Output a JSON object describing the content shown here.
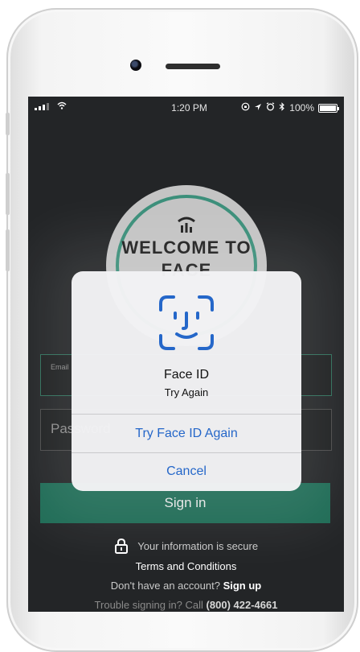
{
  "status_bar": {
    "time": "1:20 PM",
    "battery": "100%",
    "indicators": [
      "signal-icon",
      "wifi-icon",
      "rotation-lock-icon",
      "location-icon",
      "alarm-icon",
      "bluetooth-icon",
      "battery-icon"
    ]
  },
  "welcome": {
    "text": "WELCOME TO FACE",
    "ring_color": "#3b8f7a"
  },
  "login": {
    "email_placeholder": "Email",
    "password_placeholder": "Password",
    "sign_in_label": "Sign in",
    "accent": "#1e6b55"
  },
  "footer": {
    "secure_text": "Your information is secure",
    "terms": "Terms and Conditions",
    "no_account": "Don't have an account?",
    "sign_up": "Sign up",
    "trouble": "Trouble signing in? Call",
    "phone": "(800) 422-4661"
  },
  "face_id": {
    "title": "Face ID",
    "subtitle": "Try Again",
    "retry_label": "Try Face ID Again",
    "cancel_label": "Cancel",
    "glyph_color": "#2567c9"
  }
}
